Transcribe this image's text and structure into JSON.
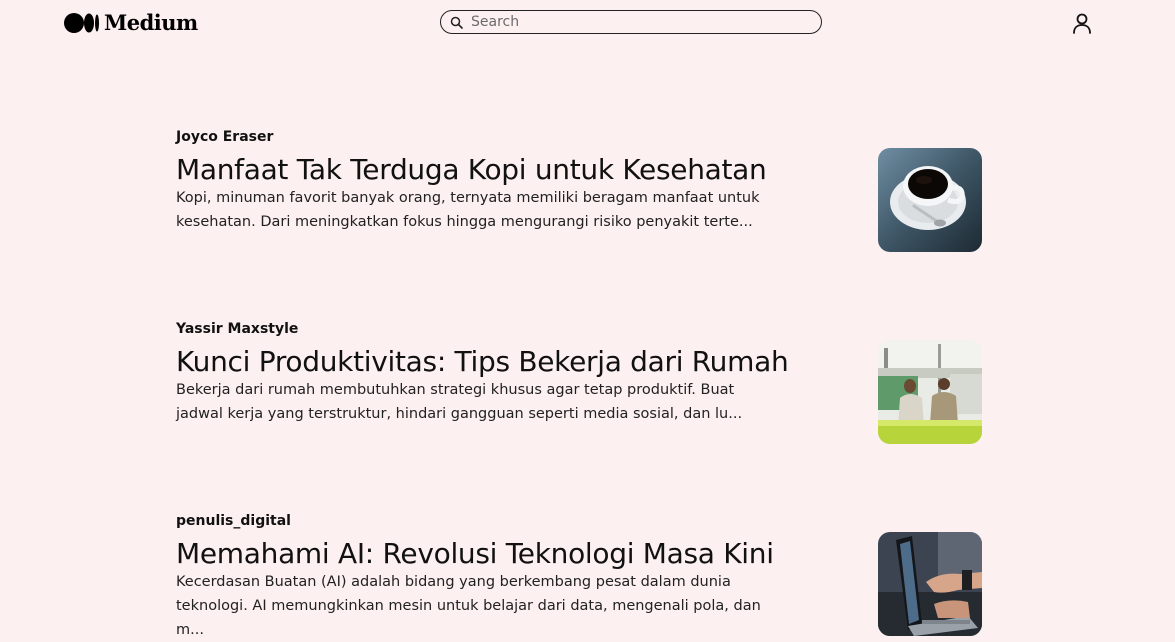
{
  "app": {
    "logo_text": "Medium"
  },
  "search": {
    "placeholder": "Search"
  },
  "icons": {
    "logo": "medium-logo-icon",
    "search": "search-icon",
    "user": "user-icon"
  },
  "articles": [
    {
      "author": "Joyco Eraser",
      "title": "Manfaat Tak Terduga Kopi untuk Kesehatan",
      "excerpt": "Kopi, minuman favorit banyak orang, ternyata memiliki beragam manfaat untuk kesehatan. Dari meningkatkan fokus hingga mengurangi risiko penyakit terte..."
    },
    {
      "author": "Yassir Maxstyle",
      "title": "Kunci Produktivitas: Tips Bekerja dari Rumah",
      "excerpt": "Bekerja dari rumah membutuhkan strategi khusus agar tetap produktif. Buat jadwal kerja yang terstruktur, hindari gangguan seperti media sosial, dan lu..."
    },
    {
      "author": "penulis_digital",
      "title": "Memahami AI: Revolusi Teknologi Masa Kini",
      "excerpt": "Kecerdasan Buatan (AI) adalah bidang yang berkembang pesat dalam dunia teknologi. AI memungkinkan mesin untuk belajar dari data, mengenali pola, dan m..."
    }
  ]
}
